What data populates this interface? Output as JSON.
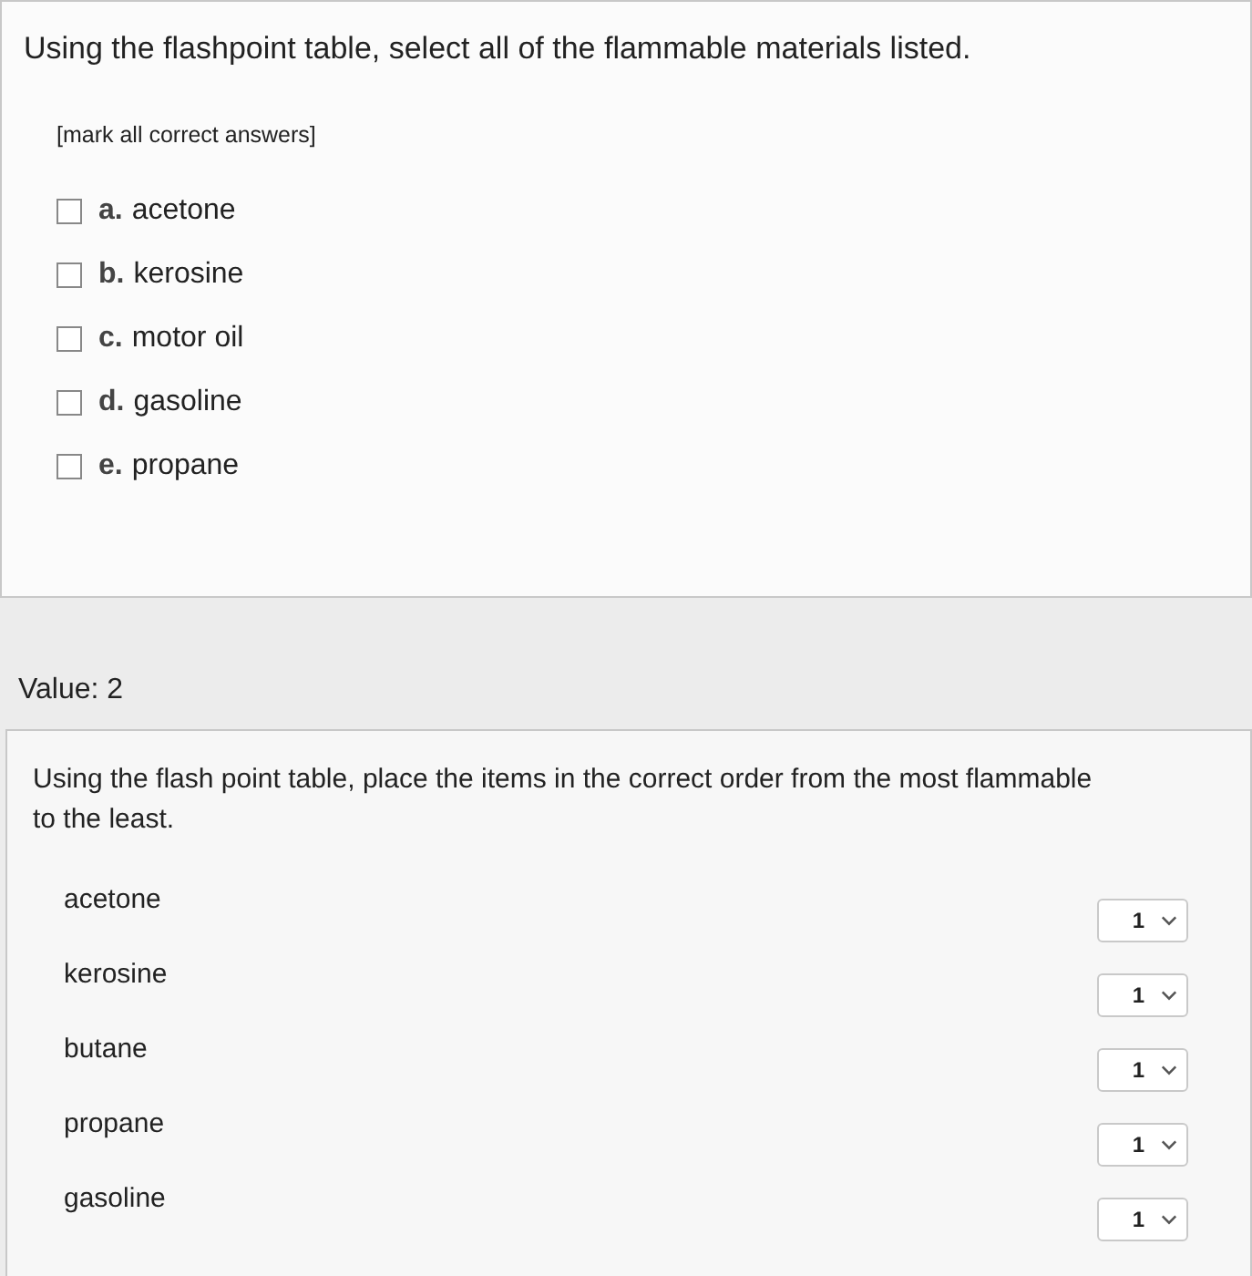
{
  "question1": {
    "prompt": "Using the flashpoint table, select all of the flammable materials listed.",
    "instruction": "[mark all correct answers]",
    "options": [
      {
        "letter": "a.",
        "text": "acetone",
        "checked": false
      },
      {
        "letter": "b.",
        "text": "kerosine",
        "checked": false
      },
      {
        "letter": "c.",
        "text": "motor oil",
        "checked": false
      },
      {
        "letter": "d.",
        "text": "gasoline",
        "checked": false
      },
      {
        "letter": "e.",
        "text": "propane",
        "checked": false
      }
    ]
  },
  "value_label": "Value: 2",
  "question2": {
    "prompt": "Using the flash point table, place the items in the correct order from the most flammable to the least.",
    "items": [
      {
        "label": "acetone",
        "rank": "1"
      },
      {
        "label": "kerosine",
        "rank": "1"
      },
      {
        "label": "butane",
        "rank": "1"
      },
      {
        "label": "propane",
        "rank": "1"
      },
      {
        "label": "gasoline",
        "rank": "1"
      }
    ]
  }
}
